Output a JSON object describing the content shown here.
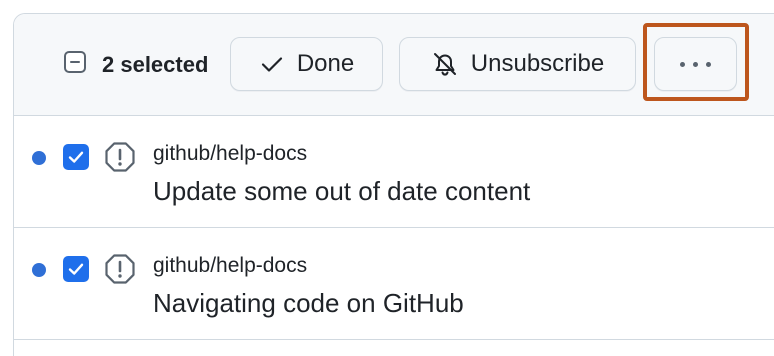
{
  "toolbar": {
    "selected_label": "2 selected",
    "done_label": "Done",
    "unsubscribe_label": "Unsubscribe",
    "more_icon": "kebab-horizontal-icon"
  },
  "notifications": [
    {
      "unread": true,
      "checked": true,
      "icon": "issue-icon",
      "repo": "github/help-docs",
      "title": "Update some out of date content"
    },
    {
      "unread": true,
      "checked": true,
      "icon": "issue-icon",
      "repo": "github/help-docs",
      "title": "Navigating code on GitHub"
    }
  ],
  "colors": {
    "accent": "#1f6feb",
    "unread_dot": "#2f6fd6",
    "highlight": "#bd561d",
    "border": "#d1d9e0"
  }
}
